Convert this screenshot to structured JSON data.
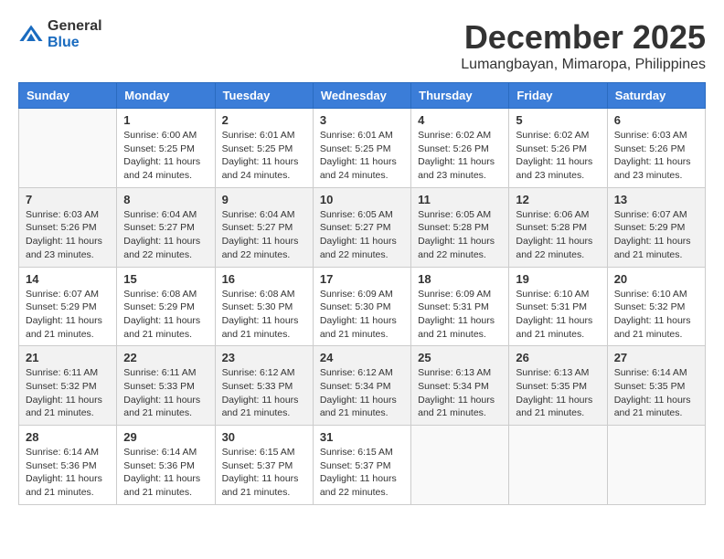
{
  "logo": {
    "general": "General",
    "blue": "Blue"
  },
  "title": "December 2025",
  "subtitle": "Lumangbayan, Mimaropa, Philippines",
  "weekdays": [
    "Sunday",
    "Monday",
    "Tuesday",
    "Wednesday",
    "Thursday",
    "Friday",
    "Saturday"
  ],
  "weeks": [
    [
      {
        "day": "",
        "info": ""
      },
      {
        "day": "1",
        "info": "Sunrise: 6:00 AM\nSunset: 5:25 PM\nDaylight: 11 hours\nand 24 minutes."
      },
      {
        "day": "2",
        "info": "Sunrise: 6:01 AM\nSunset: 5:25 PM\nDaylight: 11 hours\nand 24 minutes."
      },
      {
        "day": "3",
        "info": "Sunrise: 6:01 AM\nSunset: 5:25 PM\nDaylight: 11 hours\nand 24 minutes."
      },
      {
        "day": "4",
        "info": "Sunrise: 6:02 AM\nSunset: 5:26 PM\nDaylight: 11 hours\nand 23 minutes."
      },
      {
        "day": "5",
        "info": "Sunrise: 6:02 AM\nSunset: 5:26 PM\nDaylight: 11 hours\nand 23 minutes."
      },
      {
        "day": "6",
        "info": "Sunrise: 6:03 AM\nSunset: 5:26 PM\nDaylight: 11 hours\nand 23 minutes."
      }
    ],
    [
      {
        "day": "7",
        "info": "Sunrise: 6:03 AM\nSunset: 5:26 PM\nDaylight: 11 hours\nand 23 minutes."
      },
      {
        "day": "8",
        "info": "Sunrise: 6:04 AM\nSunset: 5:27 PM\nDaylight: 11 hours\nand 22 minutes."
      },
      {
        "day": "9",
        "info": "Sunrise: 6:04 AM\nSunset: 5:27 PM\nDaylight: 11 hours\nand 22 minutes."
      },
      {
        "day": "10",
        "info": "Sunrise: 6:05 AM\nSunset: 5:27 PM\nDaylight: 11 hours\nand 22 minutes."
      },
      {
        "day": "11",
        "info": "Sunrise: 6:05 AM\nSunset: 5:28 PM\nDaylight: 11 hours\nand 22 minutes."
      },
      {
        "day": "12",
        "info": "Sunrise: 6:06 AM\nSunset: 5:28 PM\nDaylight: 11 hours\nand 22 minutes."
      },
      {
        "day": "13",
        "info": "Sunrise: 6:07 AM\nSunset: 5:29 PM\nDaylight: 11 hours\nand 21 minutes."
      }
    ],
    [
      {
        "day": "14",
        "info": "Sunrise: 6:07 AM\nSunset: 5:29 PM\nDaylight: 11 hours\nand 21 minutes."
      },
      {
        "day": "15",
        "info": "Sunrise: 6:08 AM\nSunset: 5:29 PM\nDaylight: 11 hours\nand 21 minutes."
      },
      {
        "day": "16",
        "info": "Sunrise: 6:08 AM\nSunset: 5:30 PM\nDaylight: 11 hours\nand 21 minutes."
      },
      {
        "day": "17",
        "info": "Sunrise: 6:09 AM\nSunset: 5:30 PM\nDaylight: 11 hours\nand 21 minutes."
      },
      {
        "day": "18",
        "info": "Sunrise: 6:09 AM\nSunset: 5:31 PM\nDaylight: 11 hours\nand 21 minutes."
      },
      {
        "day": "19",
        "info": "Sunrise: 6:10 AM\nSunset: 5:31 PM\nDaylight: 11 hours\nand 21 minutes."
      },
      {
        "day": "20",
        "info": "Sunrise: 6:10 AM\nSunset: 5:32 PM\nDaylight: 11 hours\nand 21 minutes."
      }
    ],
    [
      {
        "day": "21",
        "info": "Sunrise: 6:11 AM\nSunset: 5:32 PM\nDaylight: 11 hours\nand 21 minutes."
      },
      {
        "day": "22",
        "info": "Sunrise: 6:11 AM\nSunset: 5:33 PM\nDaylight: 11 hours\nand 21 minutes."
      },
      {
        "day": "23",
        "info": "Sunrise: 6:12 AM\nSunset: 5:33 PM\nDaylight: 11 hours\nand 21 minutes."
      },
      {
        "day": "24",
        "info": "Sunrise: 6:12 AM\nSunset: 5:34 PM\nDaylight: 11 hours\nand 21 minutes."
      },
      {
        "day": "25",
        "info": "Sunrise: 6:13 AM\nSunset: 5:34 PM\nDaylight: 11 hours\nand 21 minutes."
      },
      {
        "day": "26",
        "info": "Sunrise: 6:13 AM\nSunset: 5:35 PM\nDaylight: 11 hours\nand 21 minutes."
      },
      {
        "day": "27",
        "info": "Sunrise: 6:14 AM\nSunset: 5:35 PM\nDaylight: 11 hours\nand 21 minutes."
      }
    ],
    [
      {
        "day": "28",
        "info": "Sunrise: 6:14 AM\nSunset: 5:36 PM\nDaylight: 11 hours\nand 21 minutes."
      },
      {
        "day": "29",
        "info": "Sunrise: 6:14 AM\nSunset: 5:36 PM\nDaylight: 11 hours\nand 21 minutes."
      },
      {
        "day": "30",
        "info": "Sunrise: 6:15 AM\nSunset: 5:37 PM\nDaylight: 11 hours\nand 21 minutes."
      },
      {
        "day": "31",
        "info": "Sunrise: 6:15 AM\nSunset: 5:37 PM\nDaylight: 11 hours\nand 22 minutes."
      },
      {
        "day": "",
        "info": ""
      },
      {
        "day": "",
        "info": ""
      },
      {
        "day": "",
        "info": ""
      }
    ]
  ]
}
